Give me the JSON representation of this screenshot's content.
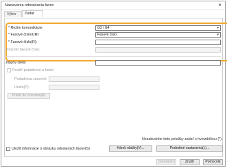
{
  "window": {
    "title": "Nastavenia odosielania faxov"
  },
  "tabs": [
    {
      "label": "Výber cieľa"
    },
    {
      "label": "Zadať cieľ"
    }
  ],
  "form": {
    "comm_mode": {
      "label": "* Režim komunikácie:",
      "value": "G3 / G4"
    },
    "fax_line": {
      "label": "* Faxové číslo/URI:",
      "value": "Faxové číslo"
    },
    "fax_number": {
      "label": "* Faxové číslo(R):",
      "value": ""
    },
    "confirm_number": {
      "label": "Potvrdiť faxové číslo:",
      "value": ""
    },
    "dest_name": {
      "label": "Názov cieľa:",
      "value": ""
    },
    "use_subaddress": {
      "label": "Použiť podadresu a heslo"
    },
    "subaddress": {
      "label": "Podadresa zároveň:"
    },
    "password": {
      "label": "Heslo(P):"
    },
    "add_button": "Pridať do zoznamu(A)",
    "hint": "Nezabudnite tieto položky zadať s hviezdičkou (*)."
  },
  "footer": {
    "save_checkbox": "Uložiť informácie o obrázku odoslaných faxov(S)",
    "cover_sheet_button": "Hárok obálky(V)...",
    "details_button": "Podrobné nastavenia(L)...",
    "ok_button": "Odoslať(D)",
    "cancel_button": "Zrušiť",
    "help_button": "Pomocník"
  }
}
